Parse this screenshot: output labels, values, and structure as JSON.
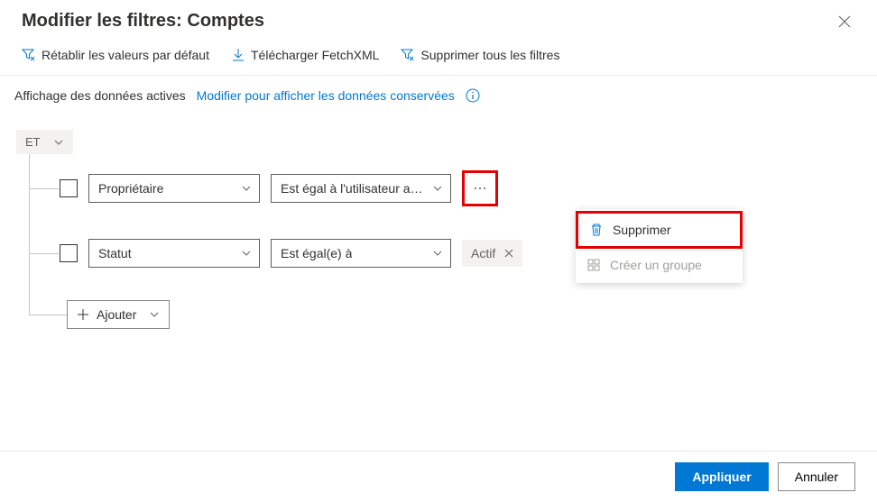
{
  "header": {
    "title": "Modifier les filtres: Comptes"
  },
  "toolbar": {
    "reset": "Rétablir les valeurs par défaut",
    "download": "Télécharger FetchXML",
    "deleteAll": "Supprimer tous les filtres"
  },
  "dataState": {
    "label": "Affichage des données actives",
    "link": "Modifier pour afficher les données conservées"
  },
  "builder": {
    "groupOp": "ET",
    "rows": [
      {
        "field": "Propriétaire",
        "operator": "Est égal à l'utilisateur ac...",
        "valueTag": null
      },
      {
        "field": "Statut",
        "operator": "Est égal(e) à",
        "valueTag": "Actif"
      }
    ],
    "addLabel": "Ajouter"
  },
  "contextMenu": {
    "delete": "Supprimer",
    "createGroup": "Créer un groupe"
  },
  "footer": {
    "apply": "Appliquer",
    "cancel": "Annuler"
  }
}
